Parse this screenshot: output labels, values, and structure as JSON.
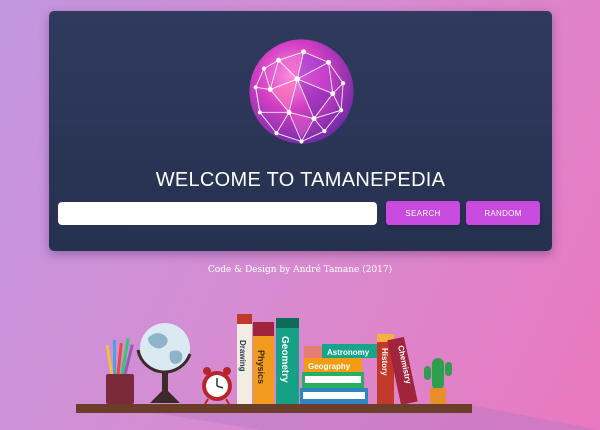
{
  "app": {
    "title": "WELCOME TO TAMANEPEDIA",
    "credit": "Code & Design by André Tamane (2017)"
  },
  "search": {
    "placeholder": "",
    "value": ""
  },
  "buttons": {
    "search_label": "SEARCH",
    "random_label": "RANDOM"
  },
  "shelf": {
    "books": [
      "Drawing",
      "Physics",
      "Geometry",
      "Astronomy",
      "Geography",
      "History",
      "Chemistry"
    ]
  },
  "colors": {
    "card_background": "#2b3658",
    "button_accent": "#c84be0",
    "page_gradient_start": "#c296e0",
    "page_gradient_end": "#ea78c0"
  },
  "icons": [
    "network-sphere-icon",
    "pencil-cup-icon",
    "globe-icon",
    "alarm-clock-icon",
    "cactus-icon"
  ]
}
